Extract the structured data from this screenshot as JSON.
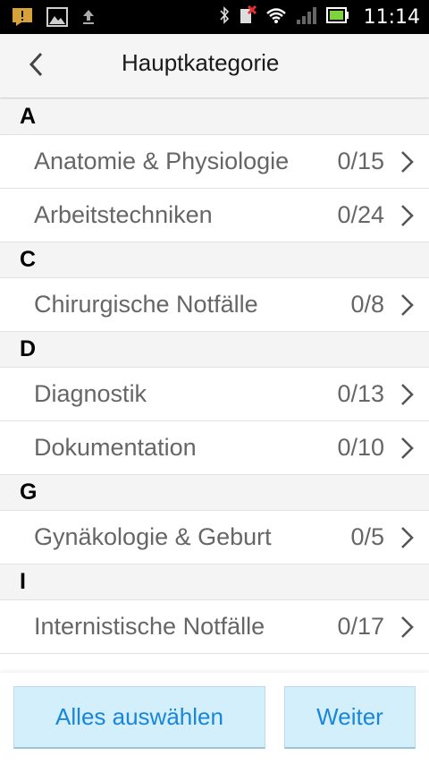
{
  "status_bar": {
    "time": "11:14",
    "icons_left": [
      "notification-icon",
      "image-icon",
      "upload-icon"
    ],
    "icons_right": [
      "bluetooth-icon",
      "sim-blocked-icon",
      "wifi-icon",
      "signal-icon",
      "battery-icon"
    ]
  },
  "header": {
    "title": "Hauptkategorie",
    "back_icon": "chevron-left-icon"
  },
  "sections": [
    {
      "letter": "A",
      "items": [
        {
          "label": "Anatomie & Physiologie",
          "count": "0/15"
        },
        {
          "label": "Arbeitstechniken",
          "count": "0/24"
        }
      ]
    },
    {
      "letter": "C",
      "items": [
        {
          "label": "Chirurgische Notfälle",
          "count": "0/8"
        }
      ]
    },
    {
      "letter": "D",
      "items": [
        {
          "label": "Diagnostik",
          "count": "0/13"
        },
        {
          "label": "Dokumentation",
          "count": "0/10"
        }
      ]
    },
    {
      "letter": "G",
      "items": [
        {
          "label": "Gynäkologie & Geburt",
          "count": "0/5"
        }
      ]
    },
    {
      "letter": "I",
      "items": [
        {
          "label": "Internistische Notfälle",
          "count": "0/17"
        }
      ]
    }
  ],
  "footer": {
    "select_all_label": "Alles auswählen",
    "next_label": "Weiter"
  },
  "colors": {
    "button_bg": "#d3effb",
    "button_text": "#1a86d8",
    "row_text": "#666666"
  }
}
